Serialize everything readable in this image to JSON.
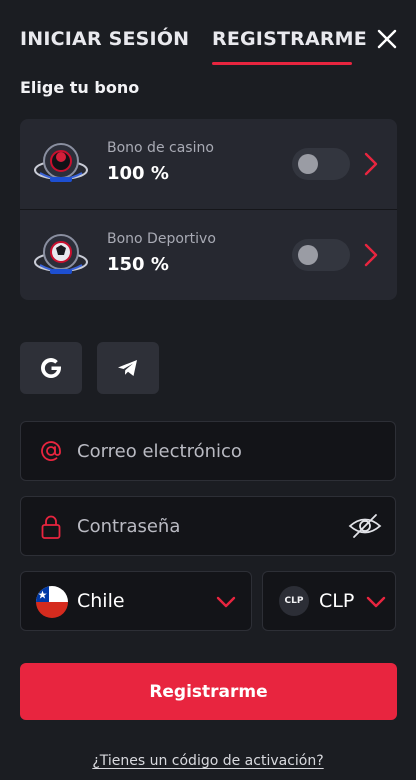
{
  "tabs": {
    "login": "INICIAR SESIÓN",
    "register": "REGISTRARME",
    "active": "register"
  },
  "close_icon": "close-icon",
  "bonus_section": {
    "title": "Elige tu bono",
    "items": [
      {
        "name": "Bono de casino",
        "value": "100 %",
        "enabled": false,
        "icon": "casino-bonus-logo"
      },
      {
        "name": "Bono Deportivo",
        "value": "150 %",
        "enabled": false,
        "icon": "sports-bonus-logo"
      }
    ]
  },
  "social": {
    "icons": [
      "google-icon",
      "telegram-icon"
    ]
  },
  "form": {
    "email_placeholder": "Correo electrónico",
    "password_placeholder": "Contraseña",
    "country": "Chile",
    "currency_code": "CLP",
    "currency": "CLP",
    "submit_label": "Registrarme",
    "activation_link": "¿Tienes un código de activación?"
  },
  "colors": {
    "accent": "#e8253f",
    "background": "#1b1d22",
    "card": "#262830",
    "input_bg": "#131418"
  }
}
